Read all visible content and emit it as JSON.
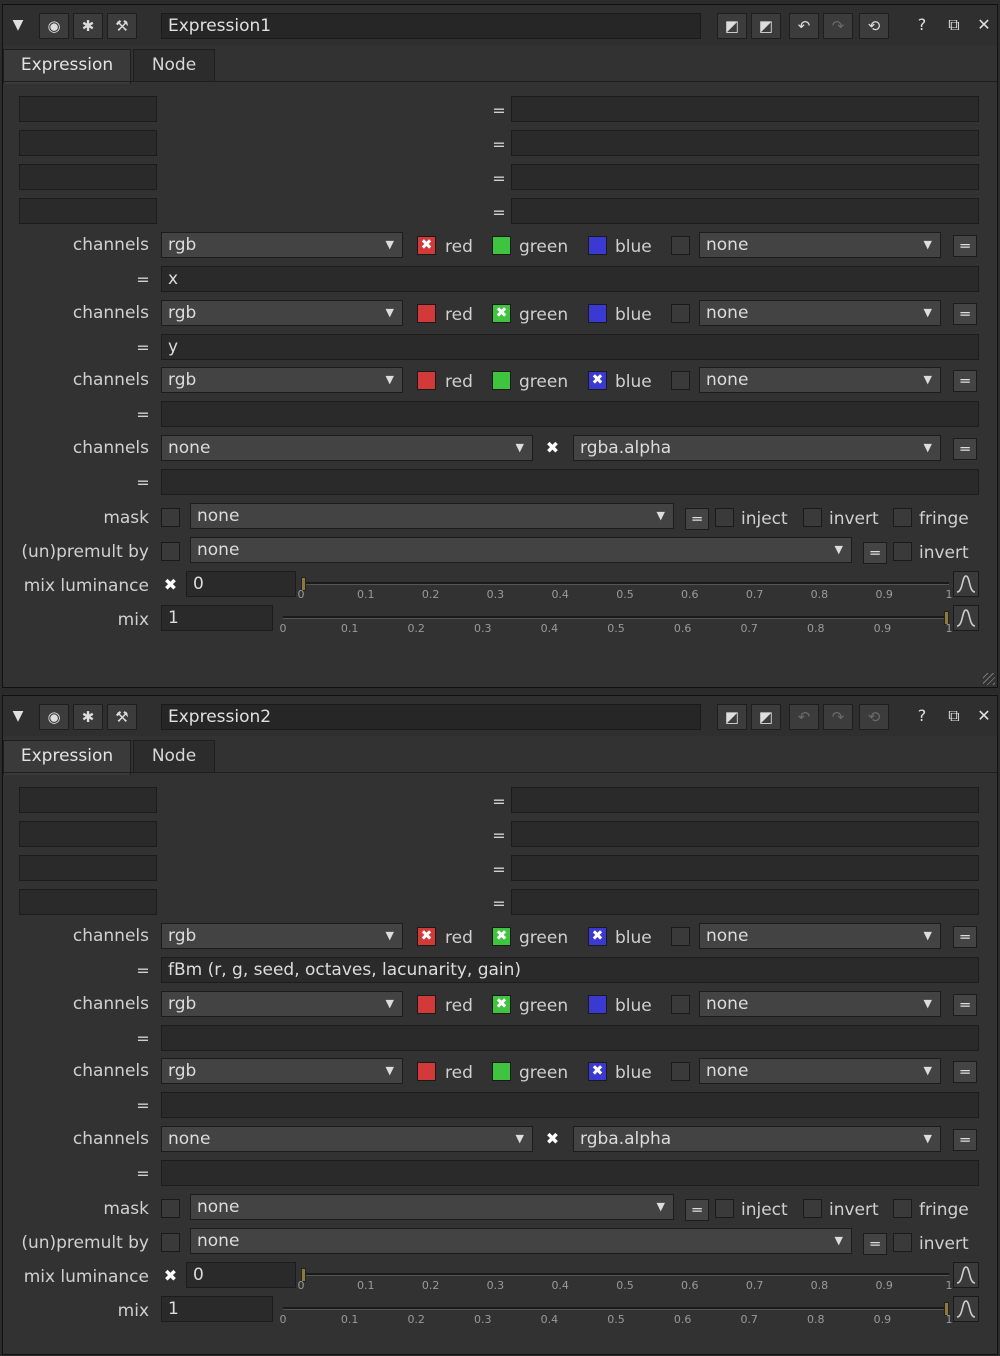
{
  "colors": {
    "red": "#d23a3a",
    "green": "#3ec43e",
    "blue": "#3a3ad2",
    "handle": "#8c7a3c"
  },
  "icons": {
    "collapse": "triangle-down",
    "viewer": "circle-dot",
    "bug": "bug",
    "wrench": "wrench",
    "undo": "undo-arrow",
    "redo": "redo-arrow",
    "revert": "revert",
    "help": "question-mark",
    "float": "float-window",
    "close": "close-x"
  },
  "tabs": {
    "expression": "Expression",
    "node": "Node"
  },
  "labels": {
    "channels": "channels",
    "eq": "=",
    "red": "red",
    "green": "green",
    "blue": "blue",
    "mask": "mask",
    "inject": "inject",
    "invert": "invert",
    "fringe": "fringe",
    "premult": "(un)premult by",
    "mixlum": "mix luminance",
    "mix": "mix"
  },
  "ticks0": [
    "0",
    "0.1",
    "0.2",
    "0.3",
    "0.4",
    "0.5",
    "0.6",
    "0.7",
    "0.8",
    "0.9",
    "1"
  ],
  "panels": [
    {
      "name": "Expression1",
      "ch": [
        {
          "value": "rgb",
          "red": true,
          "green": false,
          "blue": false,
          "fourth": "none",
          "expr": "x"
        },
        {
          "value": "rgb",
          "red": false,
          "green": true,
          "blue": false,
          "fourth": "none",
          "expr": "y"
        },
        {
          "value": "rgb",
          "red": false,
          "green": false,
          "blue": true,
          "fourth": "none",
          "expr": ""
        }
      ],
      "alpha": {
        "value": "none",
        "fourth": "rgba.alpha",
        "expr": ""
      },
      "mask": "none",
      "premult": "none",
      "mixlum": "0",
      "mix": "1"
    },
    {
      "name": "Expression2",
      "ch": [
        {
          "value": "rgb",
          "red": true,
          "green": true,
          "blue": true,
          "fourth": "none",
          "expr": "fBm (r, g, seed, octaves, lacunarity, gain)"
        },
        {
          "value": "rgb",
          "red": false,
          "green": true,
          "blue": false,
          "fourth": "none",
          "expr": ""
        },
        {
          "value": "rgb",
          "red": false,
          "green": false,
          "blue": true,
          "fourth": "none",
          "expr": ""
        }
      ],
      "alpha": {
        "value": "none",
        "fourth": "rgba.alpha",
        "expr": ""
      },
      "mask": "none",
      "premult": "none",
      "mixlum": "0",
      "mix": "1"
    }
  ]
}
